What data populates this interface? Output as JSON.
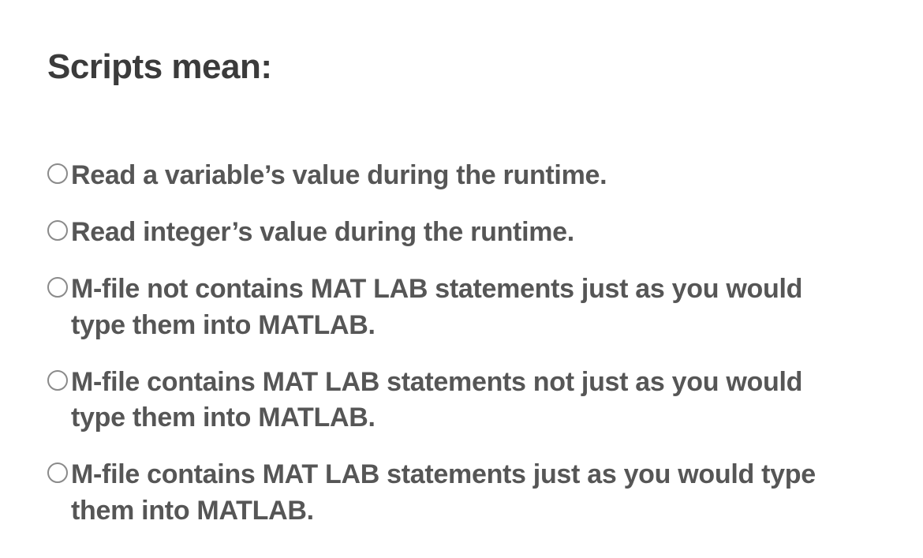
{
  "question": {
    "title": "Scripts mean:",
    "options": [
      {
        "label": "Read a variable’s value during the runtime."
      },
      {
        "label": "Read integer’s value during the runtime."
      },
      {
        "label": "M-file not contains MAT LAB statements just as you would type them into MATLAB."
      },
      {
        "label": "M-file contains MAT LAB statements not just as you would type them into MATLAB."
      },
      {
        "label": "M-file contains MAT LAB statements just as you would type them into MATLAB."
      }
    ]
  }
}
